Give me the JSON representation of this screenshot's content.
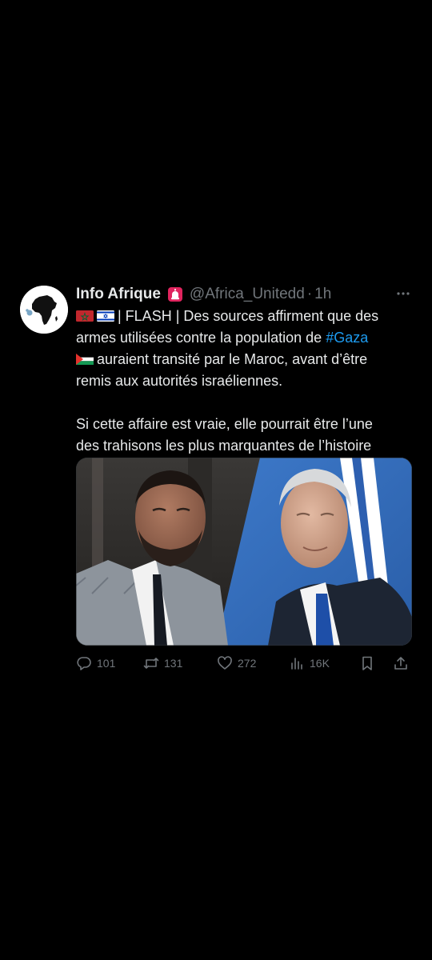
{
  "tweet": {
    "author_name": "Info Afrique",
    "author_handle": "@Africa_Unitedd",
    "separator": "·",
    "time": "1h",
    "line1_rest": "| FLASH | Des sources affirment que des",
    "line2_prefix": "armes utilisées contre la population de ",
    "hashtag": "#Gaza",
    "line3_rest": "auraient transité par le Maroc, avant d’être",
    "line4": "remis aux autorités israéliennes.",
    "para2_line1": "Si cette affaire est vraie, elle pourrait être l’une",
    "para2_line2": "des trahisons les plus marquantes de l’histoire"
  },
  "actions": {
    "replies": "101",
    "retweets": "131",
    "likes": "272",
    "views": "16K"
  },
  "icons": {
    "avatar": "africa-map-icon",
    "badge": "siren-icon",
    "flags": [
      "morocco-flag-icon",
      "israel-flag-icon",
      "palestine-flag-icon"
    ],
    "more": "more-dots-icon",
    "reply": "reply-icon",
    "retweet": "retweet-icon",
    "like": "heart-icon",
    "views": "views-chart-icon",
    "bookmark": "bookmark-icon",
    "share": "share-icon"
  },
  "colors": {
    "background": "#000000",
    "text": "#e7e9ea",
    "secondary": "#71767b",
    "link": "#1d9bf0"
  }
}
